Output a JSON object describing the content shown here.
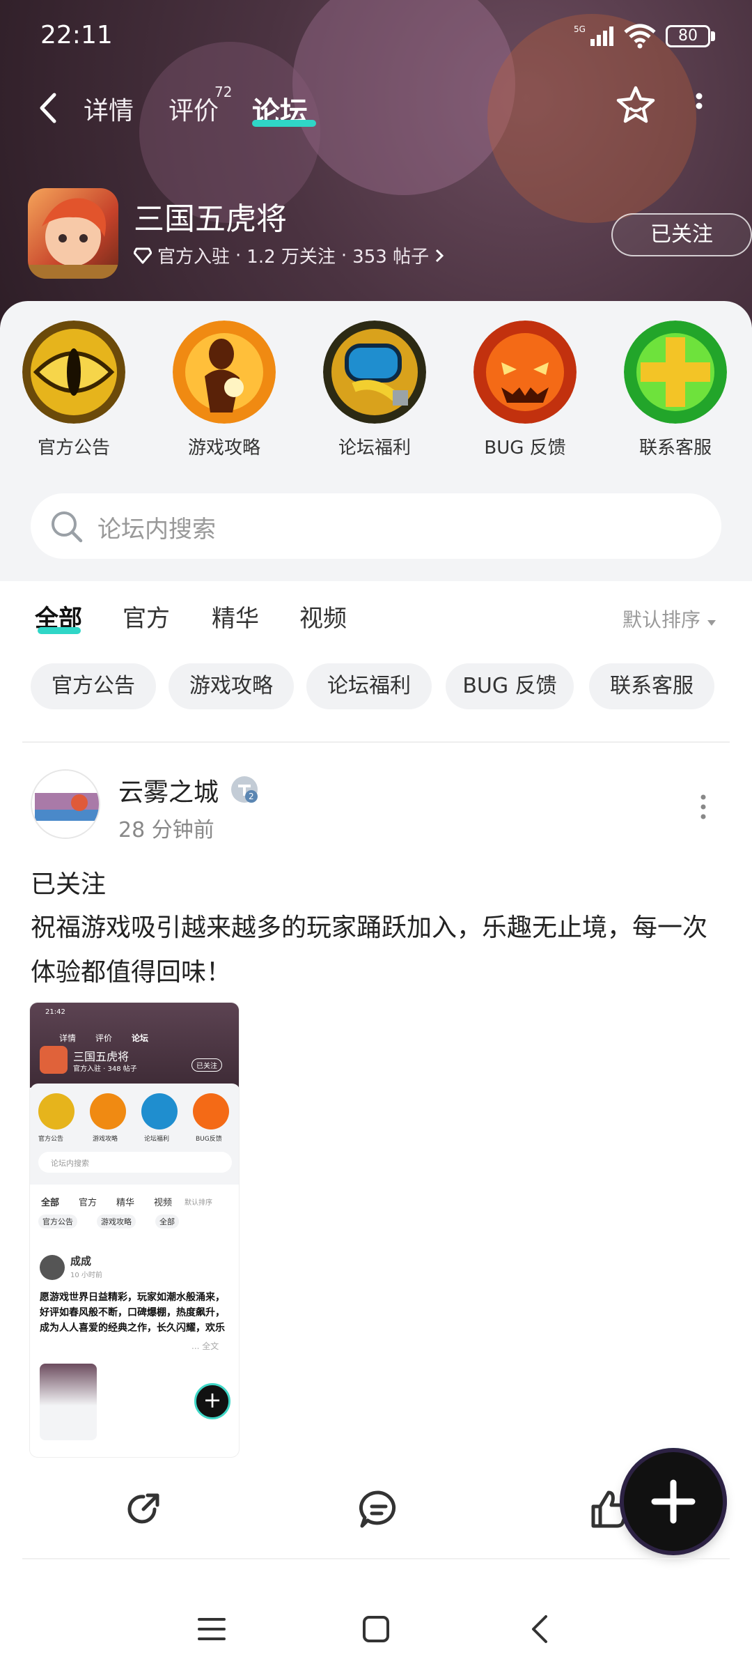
{
  "status_bar": {
    "time": "22:11",
    "network": "5G",
    "battery": "80"
  },
  "nav": {
    "tabs": [
      {
        "label": "详情"
      },
      {
        "label": "评价"
      },
      {
        "label": "论坛"
      }
    ],
    "review_count": "72",
    "active_tab": "论坛"
  },
  "game": {
    "title": "三国五虎将",
    "badge": "官方入驻",
    "followers": "1.2 万关注",
    "posts": "353 帖子",
    "follow_label": "已关注"
  },
  "categories": [
    {
      "label": "官方公告",
      "icon": "eye-icon"
    },
    {
      "label": "游戏攻略",
      "icon": "shadow-figure-icon"
    },
    {
      "label": "论坛福利",
      "icon": "fist-icon"
    },
    {
      "label": "BUG 反馈",
      "icon": "pumpkin-icon"
    },
    {
      "label": "联系客服",
      "icon": "plus-cross-icon"
    }
  ],
  "search": {
    "placeholder": "论坛内搜索"
  },
  "filter_tabs": [
    {
      "label": "全部"
    },
    {
      "label": "官方"
    },
    {
      "label": "精华"
    },
    {
      "label": "视频"
    }
  ],
  "sort_label": "默认排序",
  "chips": [
    {
      "label": "官方公告"
    },
    {
      "label": "游戏攻略"
    },
    {
      "label": "论坛福利"
    },
    {
      "label": "BUG 反馈"
    },
    {
      "label": "联系客服"
    }
  ],
  "post": {
    "author": "云雾之城",
    "level": "2",
    "time": "28 分钟前",
    "line1": "已关注",
    "body": "祝福游戏吸引越来越多的玩家踊跃加入，乐趣无止境，每一次体验都值得回味！",
    "image": {
      "time": "21:42",
      "tabs": [
        "详情",
        "评价",
        "论坛"
      ],
      "title": "三国五虎将",
      "meta": "官方入驻 · 348 帖子",
      "follow": "已关注",
      "cats": [
        "官方公告",
        "游戏攻略",
        "论坛福利",
        "BUG反馈"
      ],
      "search": "论坛内搜索",
      "ftabs": [
        "全部",
        "官方",
        "精华",
        "视频"
      ],
      "sort": "默认排序",
      "chips": [
        "官方公告",
        "游戏攻略",
        "全部"
      ],
      "author": "成成",
      "ptime": "10 小时前",
      "text": "愿游戏世界日益精彩，玩家如潮水般涌来，好评如春风般不断，口碑爆棚，热度飙升，成为人人喜爱的经典之作，长久闪耀，欢乐",
      "more": "... 全文"
    }
  },
  "colors": {
    "accent": "#2fd6c7",
    "header_bg": "#4b3341",
    "panel_bg": "#f3f4f6"
  }
}
